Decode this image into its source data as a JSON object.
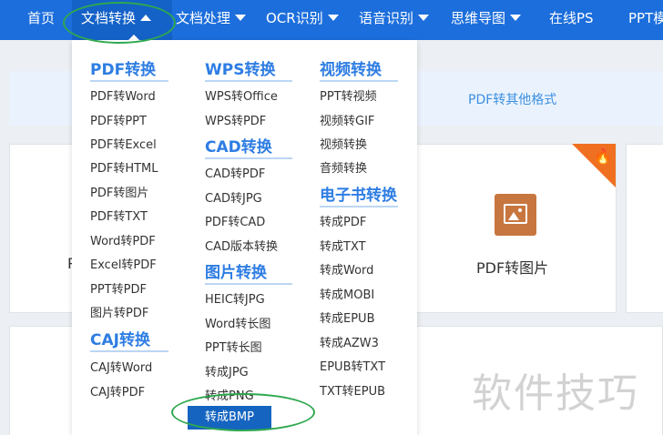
{
  "nav": {
    "items": [
      {
        "label": "首页"
      },
      {
        "label": "文档转换"
      },
      {
        "label": "文档处理"
      },
      {
        "label": "OCR识别"
      },
      {
        "label": "语音识别"
      },
      {
        "label": "思维导图"
      },
      {
        "label": "在线PS"
      },
      {
        "label": "PPT模"
      }
    ]
  },
  "banner": {
    "text": "PDF转其他格式"
  },
  "card": {
    "label": "PDF转图片",
    "clipped_label": "P",
    "icon": "image-icon",
    "hot_icon": "fire-icon"
  },
  "watermark": "软件技巧",
  "dropdown": {
    "col1": {
      "sections": [
        {
          "title": "PDF转换",
          "items": [
            "PDF转Word",
            "PDF转PPT",
            "PDF转Excel",
            "PDF转HTML",
            "PDF转图片",
            "PDF转TXT",
            "Word转PDF",
            "Excel转PDF",
            "PPT转PDF",
            "图片转PDF"
          ]
        },
        {
          "title": "CAJ转换",
          "items": [
            "CAJ转Word",
            "CAJ转PDF"
          ]
        }
      ]
    },
    "col2": {
      "sections": [
        {
          "title": "WPS转换",
          "items": [
            "WPS转Office",
            "WPS转PDF"
          ]
        },
        {
          "title": "CAD转换",
          "items": [
            "CAD转PDF",
            "CAD转JPG",
            "PDF转CAD",
            "CAD版本转换"
          ]
        },
        {
          "title": "图片转换",
          "items": [
            "HEIC转JPG",
            "Word转长图",
            "PPT转长图",
            "转成JPG",
            "转成PNG",
            "转成BMP"
          ]
        }
      ]
    },
    "col3": {
      "sections": [
        {
          "title": "视频转换",
          "items": [
            "PPT转视频",
            "视频转GIF",
            "视频转换",
            "音频转换"
          ]
        },
        {
          "title": "电子书转换",
          "items": [
            "转成PDF",
            "转成TXT",
            "转成Word",
            "转成MOBI",
            "转成EPUB",
            "转成AZW3",
            "EPUB转TXT",
            "TXT转EPUB"
          ]
        }
      ]
    }
  },
  "colors": {
    "nav_bg": "#1c6edc",
    "accent": "#2e7de3",
    "highlight": "#1565c0",
    "annotation": "#2fa84f"
  }
}
